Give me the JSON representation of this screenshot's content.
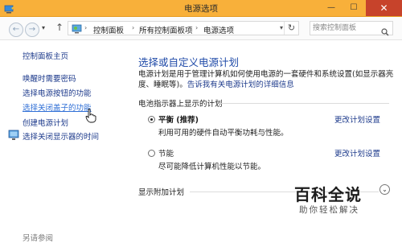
{
  "window": {
    "title": "电源选项",
    "minimize_glyph": "—",
    "maximize_glyph": "☐",
    "close_glyph": "✕"
  },
  "nav": {
    "back_glyph": "←",
    "forward_glyph": "→",
    "dropdown_glyph": "▾",
    "up_glyph": "↑",
    "separator_glyph": "›",
    "refresh_glyph": "↻",
    "breadcrumbs": [
      "控制面板",
      "所有控制面板项",
      "电源选项"
    ],
    "search_placeholder": "搜索控制面板"
  },
  "sidebar": {
    "items": [
      {
        "label": "控制面板主页"
      },
      {
        "label": "唤醒时需要密码"
      },
      {
        "label": "选择电源按钮的功能"
      },
      {
        "label": "选择关闭盖子的功能"
      },
      {
        "label": "创建电源计划"
      },
      {
        "label": "选择关闭显示器的时间"
      }
    ],
    "see_also": "另请参阅"
  },
  "main": {
    "heading": "选择或自定义电源计划",
    "description_line1": "电源计划是用于管理计算机如何使用电源的一套硬件和系统设置(如显示器亮",
    "description_prefix": "度、睡眠等)。",
    "description_link": "告诉我有关电源计划的详细信息",
    "group_label": "电池指示器上显示的计划",
    "plans": [
      {
        "name": "平衡 (推荐)",
        "description": "利用可用的硬件自动平衡功耗与性能。",
        "selected": true,
        "change_label": "更改计划设置"
      },
      {
        "name": "节能",
        "description": "尽可能降低计算机性能以节能。",
        "selected": false,
        "change_label": "更改计划设置"
      }
    ],
    "additional_label": "显示附加计划",
    "expand_glyph": "⌄"
  },
  "watermark": {
    "line1": "百科全说",
    "line2": "助你轻松解决"
  },
  "colors": {
    "titlebar": "#f8b03a",
    "close_button": "#c7432b",
    "link": "#1e3b8c",
    "heading": "#1f4aa8"
  }
}
